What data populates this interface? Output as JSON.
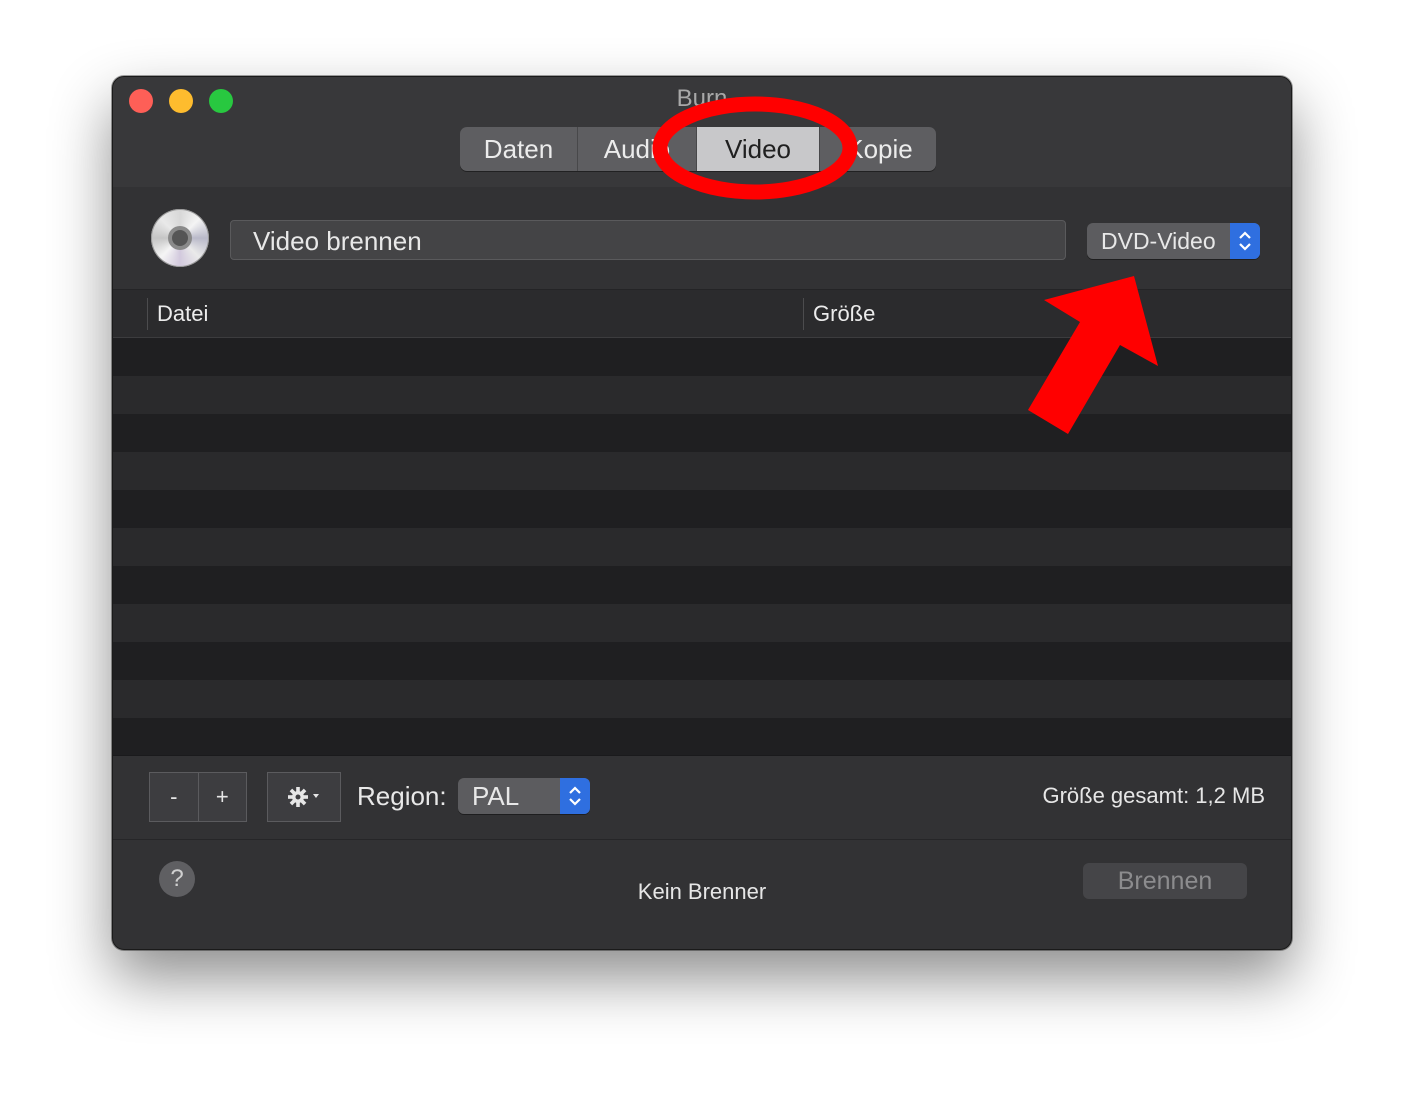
{
  "window": {
    "title": "Burn",
    "tabs": [
      {
        "label": "Daten",
        "active": false
      },
      {
        "label": "Audio",
        "active": false
      },
      {
        "label": "Video",
        "active": true
      },
      {
        "label": "Kopie",
        "active": false
      }
    ]
  },
  "header": {
    "disc_name": "Video brennen",
    "format_select": "DVD-Video"
  },
  "table": {
    "columns": [
      "Datei",
      "Größe"
    ],
    "rows": []
  },
  "bottom": {
    "remove_label": "-",
    "add_label": "+",
    "region_label": "Region:",
    "region_value": "PAL",
    "total_size": "Größe gesamt: 1,2 MB"
  },
  "footer": {
    "help_label": "?",
    "status": "Kein Brenner",
    "burn_label": "Brennen"
  },
  "colors": {
    "accent": "#2f6fe0",
    "annotation": "#ff0000",
    "window_bg": "#323234"
  }
}
